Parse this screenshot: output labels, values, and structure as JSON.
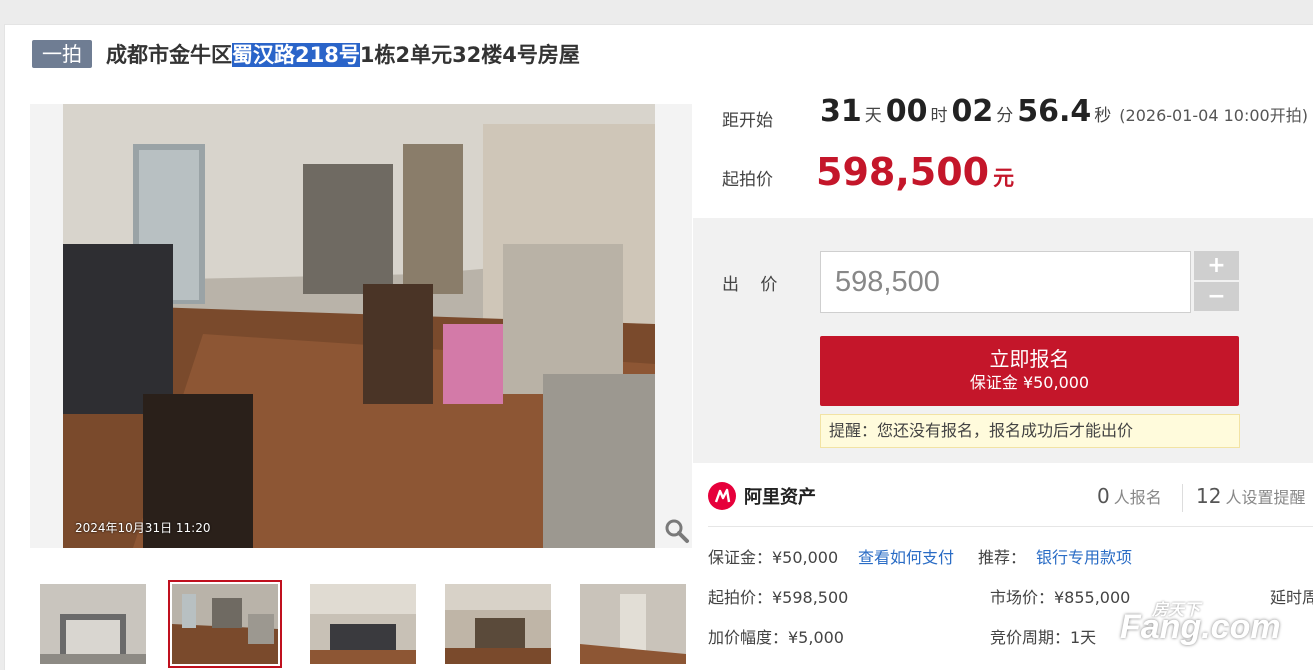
{
  "title": {
    "tag": "一拍",
    "prefix": "成都市金牛区",
    "highlight": "蜀汉路218号",
    "suffix": "1栋2单元32楼4号房屋"
  },
  "photo": {
    "stamp": "2024年10月31日 11:20"
  },
  "thumbnails": [
    {
      "name": "exterior"
    },
    {
      "name": "living-room",
      "active": true
    },
    {
      "name": "bedroom-1"
    },
    {
      "name": "bedroom-2"
    },
    {
      "name": "hallway"
    }
  ],
  "countdown": {
    "label": "距开始",
    "days": "31",
    "days_unit": "天",
    "hours": "00",
    "hours_unit": "时",
    "minutes": "02",
    "minutes_unit": "分",
    "seconds": "56.4",
    "seconds_unit": "秒",
    "start_note": "(2026-01-04 10:00开拍)"
  },
  "starting_price": {
    "label": "起拍价",
    "value": "598,500",
    "unit": "元"
  },
  "bid": {
    "label": "出 价",
    "value": "598,500",
    "plus": "+",
    "minus": "−"
  },
  "register_button": {
    "label": "立即报名",
    "deposit": "保证金 ¥50,000"
  },
  "reminder": "提醒：您还没有报名，报名成功后才能出价",
  "brand": {
    "name": "阿里资产",
    "registered_count": "0",
    "registered_label": "人报名",
    "reminder_count": "12",
    "reminder_label": "人设置提醒"
  },
  "details": {
    "deposit": "保证金：¥50,000",
    "how_to_pay": "查看如何支付",
    "recommend_label": "推荐：",
    "recommend_link": "银行专用款项",
    "start_price": "起拍价：¥598,500",
    "market_price": "市场价：¥855,000",
    "delay": "延时周",
    "increment": "加价幅度：¥5,000",
    "cycle": "竞价周期：1天"
  },
  "watermark": {
    "top": "房天下",
    "main": "Fang.com"
  },
  "colors": {
    "accent_red": "#c4162a",
    "link_blue": "#2a6cc5",
    "tag_gray": "#6f7d93"
  }
}
